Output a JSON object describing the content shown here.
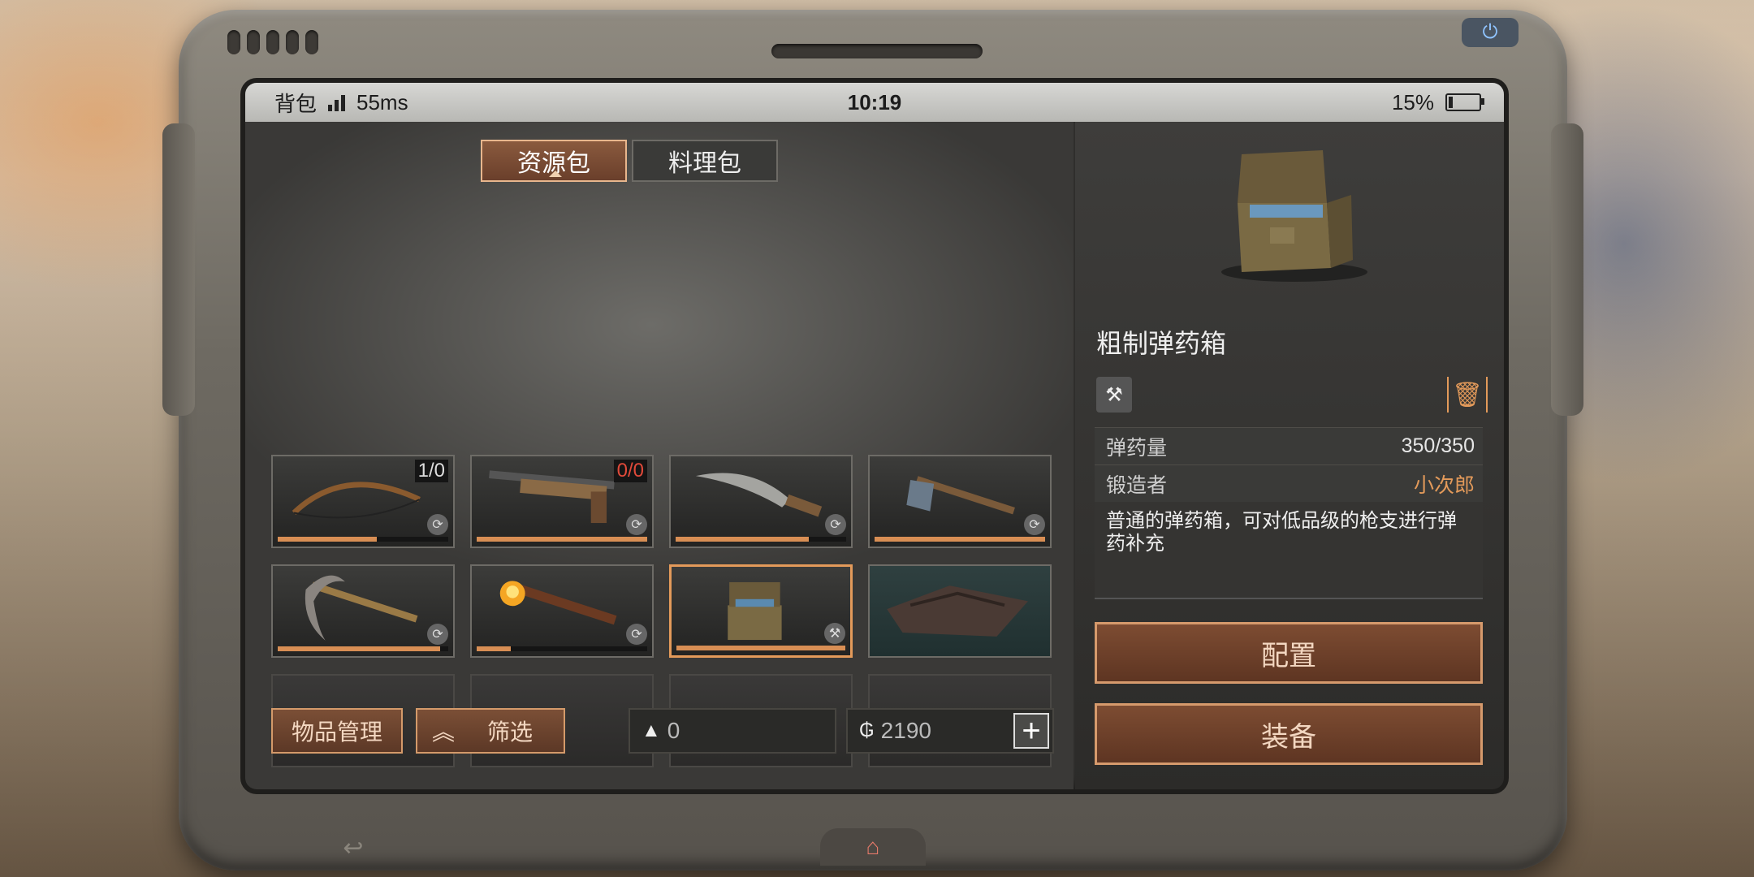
{
  "status_bar": {
    "app_label": "背包",
    "ping": "55ms",
    "time": "10:19",
    "battery": "15%"
  },
  "tabs": [
    {
      "label": "资源包",
      "active": true
    },
    {
      "label": "料理包",
      "active": false
    }
  ],
  "inventory": [
    {
      "name": "bow",
      "count": "1/0",
      "count_color": "white",
      "durability": 0.58,
      "icon": "craft-icon"
    },
    {
      "name": "shotgun",
      "count": "0/0",
      "count_color": "red",
      "durability": 1.0,
      "icon": "craft-icon"
    },
    {
      "name": "machete",
      "durability": 0.78,
      "icon": "craft-icon"
    },
    {
      "name": "axe",
      "durability": 1.0,
      "icon": "craft-icon"
    },
    {
      "name": "pickaxe",
      "durability": 0.95,
      "icon": "craft-icon"
    },
    {
      "name": "torch",
      "durability": 0.2,
      "icon": "craft-icon"
    },
    {
      "name": "ammo-box",
      "durability": 1.0,
      "icon": "hammer-icon",
      "selected": true
    },
    {
      "name": "leather",
      "durability": 0.0
    }
  ],
  "buttons": {
    "manage": "物品管理",
    "filter": "筛选"
  },
  "resources": {
    "gold": "0",
    "coins": "2190"
  },
  "detail": {
    "name": "粗制弹药箱",
    "stats": [
      {
        "key": "弹药量",
        "value": "350/350"
      },
      {
        "key": "锻造者",
        "value": "小次郎"
      }
    ],
    "description": "普通的弹药箱，可对低品级的枪支进行弹药补充",
    "configure": "配置",
    "equip": "装备"
  },
  "colors": {
    "accent": "#e39a5a",
    "button_bg": "#6a3f2b"
  }
}
